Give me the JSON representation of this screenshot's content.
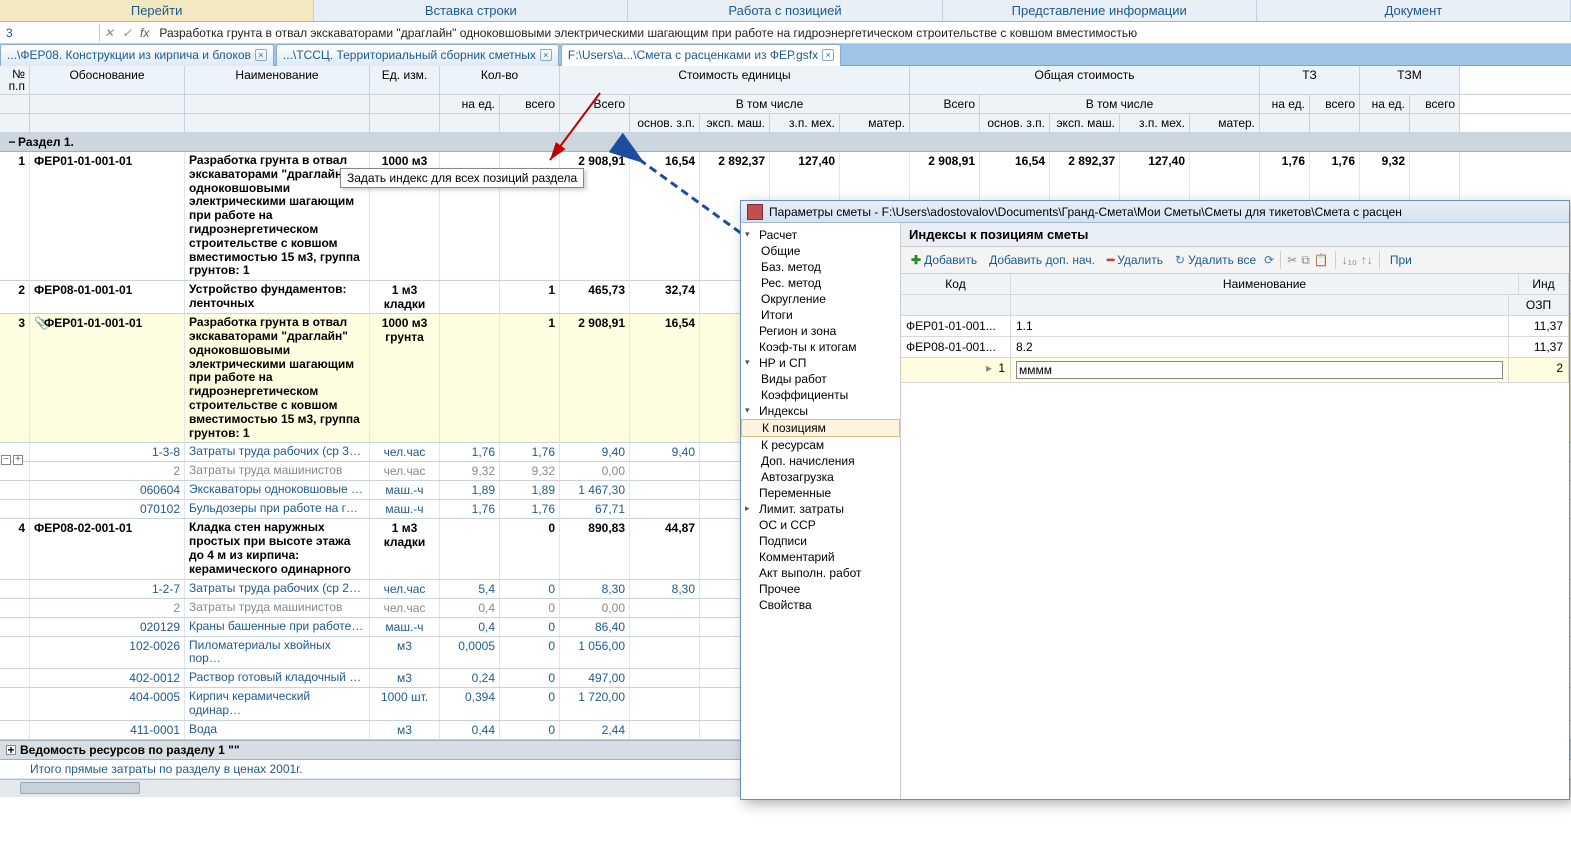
{
  "ribbon": {
    "tabs": [
      "Перейти",
      "Вставка строки",
      "Работа с позицией",
      "Представление информации",
      "Документ"
    ]
  },
  "formula_bar": {
    "cell_ref": "3",
    "btn_x": "✕",
    "btn_chk": "✓",
    "fx": "fx",
    "formula": "Разработка грунта в отвал экскаваторами \"драглайн\" одноковшовыми электрическими шагающим при работе на гидроэнергетическом строительстве с ковшом вместимостью"
  },
  "doc_tabs": [
    {
      "label": "...\\ФЕР08. Конструкции из кирпича и блоков"
    },
    {
      "label": "...\\ТССЦ. Территориальный сборник сметных"
    },
    {
      "label": "F:\\Users\\a...\\Смета с расценками из ФЕР.gsfx",
      "active": true
    }
  ],
  "grid_headers": {
    "np": "№\nп.п",
    "obosn": "Обоснование",
    "naim": "Наименование",
    "ed": "Ед. изм.",
    "kolvo": "Кол-во",
    "naed": "на ед.",
    "vsego": "всего",
    "vsego_cap": "Всего",
    "stoimost_ed": "Стоимость единицы",
    "stoimost_ob": "Общая стоимость",
    "vtom": "В том числе",
    "osn": "основ. з.п.",
    "eksp": "эксп. маш.",
    "zpmeh": "з.п. мех.",
    "mater": "матер.",
    "tz": "ТЗ",
    "tzm": "ТЗМ"
  },
  "section1": "Раздел 1.",
  "tooltip": "Задать индекс для всех позиций раздела",
  "rows": [
    {
      "np": "1",
      "obosn": "ФЕР01-01-001-01",
      "naim": "Разработка грунта в отвал экскаваторами \"драглайн\" одноковшовыми электрическими шагающим при работе на гидроэнергетическом строительстве с ковшом вместимостью 15 м3, группа грунтов: 1",
      "ed": "1000 м3",
      "naed": "",
      "vsego1": "",
      "vsego2": "2 908,91",
      "osn": "16,54",
      "eksp": "2 892,37",
      "zpmeh": "127,40",
      "mater": "",
      "vsego3": "2 908,91",
      "osn2": "16,54",
      "eksp2": "2 892,37",
      "zpmeh2": "127,40",
      "mater2": "",
      "tz1": "1,76",
      "tz2": "1,76",
      "tzm1": "9,32",
      "tzm2": "",
      "bold": true
    },
    {
      "np": "2",
      "obosn": "ФЕР08-01-001-01",
      "naim": "Устройство фундаментов: ленточных",
      "ed": "1 м3 кладки",
      "naed": "",
      "vsego1": "1",
      "vsego2": "465,73",
      "osn": "32,74",
      "eksp": "",
      "zpmeh": "",
      "mater": "",
      "bold": true
    },
    {
      "np": "3",
      "obosn": "ФЕР01-01-001-01",
      "naim": "Разработка грунта в отвал экскаваторами \"драглайн\" одноковшовыми электрическими шагающим при работе на гидроэнергетическом строительстве с ковшом вместимостью 15 м3, группа грунтов: 1",
      "ed": "1000 м3 грунта",
      "naed": "",
      "vsego1": "1",
      "vsego2": "2 908,91",
      "osn": "16,54",
      "eksp": "",
      "zpmeh": "",
      "mater": "",
      "bold": true,
      "yellow": true,
      "attach": true
    },
    {
      "np": "",
      "obosn": "1-3-8",
      "naim": "Затраты труда рабочих (ср 3…",
      "ed": "чел.час",
      "naed": "1,76",
      "vsego1": "1,76",
      "vsego2": "9,40",
      "osn": "9,40",
      "link": true
    },
    {
      "np": "",
      "obosn": "2",
      "naim": "Затраты труда машинистов",
      "ed": "чел.час",
      "naed": "9,32",
      "vsego1": "9,32",
      "vsego2": "0,00",
      "gray": true
    },
    {
      "np": "",
      "obosn": "060604",
      "naim": "Экскаваторы одноковшовые …",
      "ed": "маш.-ч",
      "naed": "1,89",
      "vsego1": "1,89",
      "vsego2": "1 467,30",
      "link": true
    },
    {
      "np": "",
      "obosn": "070102",
      "naim": "Бульдозеры при работе на г…",
      "ed": "маш.-ч",
      "naed": "1,76",
      "vsego1": "1,76",
      "vsego2": "67,71",
      "link": true
    },
    {
      "np": "4",
      "obosn": "ФЕР08-02-001-01",
      "naim": "Кладка стен наружных простых при высоте этажа до 4 м из кирпича: керамического одинарного",
      "ed": "1 м3 кладки",
      "naed": "",
      "vsego1": "0",
      "vsego2": "890,83",
      "osn": "44,87",
      "bold": true
    },
    {
      "np": "",
      "obosn": "1-2-7",
      "naim": "Затраты труда рабочих (ср 2…",
      "ed": "чел.час",
      "naed": "5,4",
      "vsego1": "0",
      "vsego2": "8,30",
      "osn": "8,30",
      "link": true
    },
    {
      "np": "",
      "obosn": "2",
      "naim": "Затраты труда машинистов",
      "ed": "чел.час",
      "naed": "0,4",
      "vsego1": "0",
      "vsego2": "0,00",
      "gray": true
    },
    {
      "np": "",
      "obosn": "020129",
      "naim": "Краны башенные при работе…",
      "ed": "маш.-ч",
      "naed": "0,4",
      "vsego1": "0",
      "vsego2": "86,40",
      "link": true
    },
    {
      "np": "",
      "obosn": "102-0026",
      "naim": "Пиломатериалы хвойных пор…",
      "ed": "м3",
      "naed": "0,0005",
      "vsego1": "0",
      "vsego2": "1 056,00",
      "link": true
    },
    {
      "np": "",
      "obosn": "402-0012",
      "naim": "Раствор готовый кладочный …",
      "ed": "м3",
      "naed": "0,24",
      "vsego1": "0",
      "vsego2": "497,00",
      "link": true
    },
    {
      "np": "",
      "obosn": "404-0005",
      "naim": "Кирпич керамический одинар…",
      "ed": "1000 шт.",
      "naed": "0,394",
      "vsego1": "0",
      "vsego2": "1 720,00",
      "link": true
    },
    {
      "np": "",
      "obosn": "411-0001",
      "naim": "Вода",
      "ed": "м3",
      "naed": "0,44",
      "vsego1": "0",
      "vsego2": "2,44",
      "link": true
    }
  ],
  "footer_section": "Ведомость ресурсов по разделу 1 \"\"",
  "footer_row": "Итого прямые затраты по разделу в ценах 2001г.",
  "params": {
    "title": "Параметры сметы - F:\\Users\\adostovalov\\Documents\\Гранд-Смета\\Мои Сметы\\Сметы для тикетов\\Смета с расцен",
    "tree": [
      {
        "lbl": "Расчет",
        "lvl": 0,
        "t": "▾"
      },
      {
        "lbl": "Общие",
        "lvl": 1
      },
      {
        "lbl": "Баз. метод",
        "lvl": 1
      },
      {
        "lbl": "Рес. метод",
        "lvl": 1
      },
      {
        "lbl": "Округление",
        "lvl": 1
      },
      {
        "lbl": "Итоги",
        "lvl": 1
      },
      {
        "lbl": "Регион и зона",
        "lvl": 0
      },
      {
        "lbl": "Коэф-ты к итогам",
        "lvl": 0
      },
      {
        "lbl": "НР и СП",
        "lvl": 0,
        "t": "▾"
      },
      {
        "lbl": "Виды работ",
        "lvl": 1
      },
      {
        "lbl": "Коэффициенты",
        "lvl": 1
      },
      {
        "lbl": "Индексы",
        "lvl": 0,
        "t": "▾"
      },
      {
        "lbl": "К позициям",
        "lvl": 1,
        "sel": true
      },
      {
        "lbl": "К ресурсам",
        "lvl": 1
      },
      {
        "lbl": "Доп. начисления",
        "lvl": 1
      },
      {
        "lbl": "Автозагрузка",
        "lvl": 1
      },
      {
        "lbl": "Переменные",
        "lvl": 0
      },
      {
        "lbl": "Лимит. затраты",
        "lvl": 0,
        "t": "▸"
      },
      {
        "lbl": "ОС и ССР",
        "lvl": 0
      },
      {
        "lbl": "Подписи",
        "lvl": 0
      },
      {
        "lbl": "Комментарий",
        "lvl": 0
      },
      {
        "lbl": "Акт выполн. работ",
        "lvl": 0
      },
      {
        "lbl": "Прочее",
        "lvl": 0
      },
      {
        "lbl": "Свойства",
        "lvl": 0
      }
    ],
    "main_header": "Индексы к позициям сметы",
    "toolbar": {
      "add": "Добавить",
      "add_dop": "Добавить доп. нач.",
      "delete": "Удалить",
      "delete_all": "Удалить все",
      "pri": "При"
    },
    "idx_hdr": {
      "code": "Код",
      "naim": "Наименование",
      "ind": "Инд",
      "ozp": "ОЗП"
    },
    "idx_rows": [
      {
        "code": "ФЕР01-01-001...",
        "naim": "1.1",
        "ozp": "11,37"
      },
      {
        "code": "ФЕР08-01-001...",
        "naim": "8.2",
        "ozp": "11,37"
      }
    ],
    "idx_edit": {
      "code": "1",
      "naim": "мммм",
      "ozp": "2"
    }
  }
}
